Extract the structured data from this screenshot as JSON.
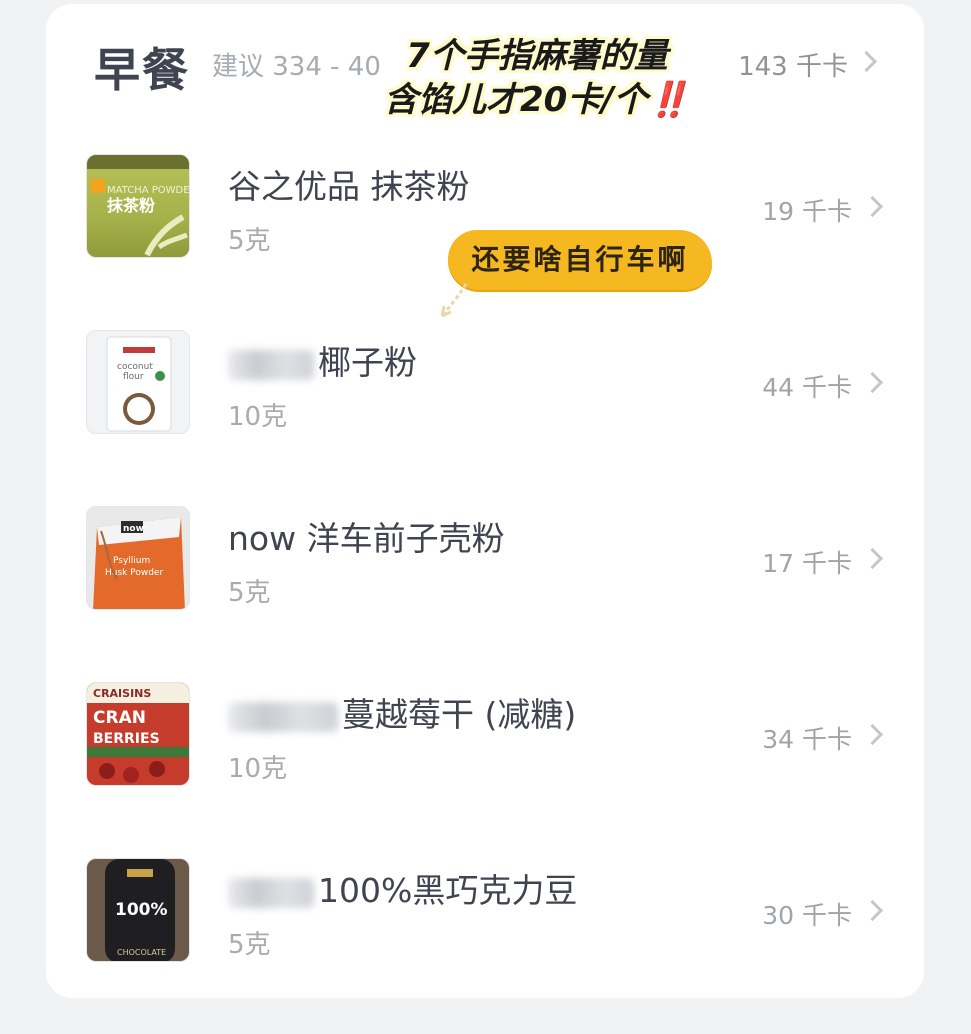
{
  "meal": {
    "title": "早餐",
    "suggestion": "建议 334 - 40",
    "total": "143 千卡"
  },
  "annotations": {
    "caption_line1": "7个手指麻薯的量",
    "caption_line2": "含馅儿才20卡/个",
    "caption_emoji": "‼️",
    "sticker": "还要啥自行车啊"
  },
  "foods": [
    {
      "name": "谷之优品 抹茶粉",
      "amount": "5克",
      "kcal": "19 千卡",
      "thumb_label": "MATCHA POWDER 抹茶粉"
    },
    {
      "name": "椰子粉",
      "amount": "10克",
      "kcal": "44 千卡",
      "thumb_label": "coconut flour"
    },
    {
      "name": "now 洋车前子壳粉",
      "amount": "5克",
      "kcal": "17 千卡",
      "thumb_label": "Psyllium Husk Powder"
    },
    {
      "name": "蔓越莓干 (减糖)",
      "amount": "10克",
      "kcal": "34 千卡",
      "thumb_label": "CRAISINS DRIED CRAN BERRIES"
    },
    {
      "name": "100%黑巧克力豆",
      "amount": "5克",
      "kcal": "30 千卡",
      "thumb_label": "100% CHOCOLATE"
    }
  ],
  "colors": {
    "matcha": "#a6b24a",
    "orange_bag": "#e36a2a",
    "sticker": "#f6b821",
    "dark_bottle": "#2a2a2e"
  }
}
